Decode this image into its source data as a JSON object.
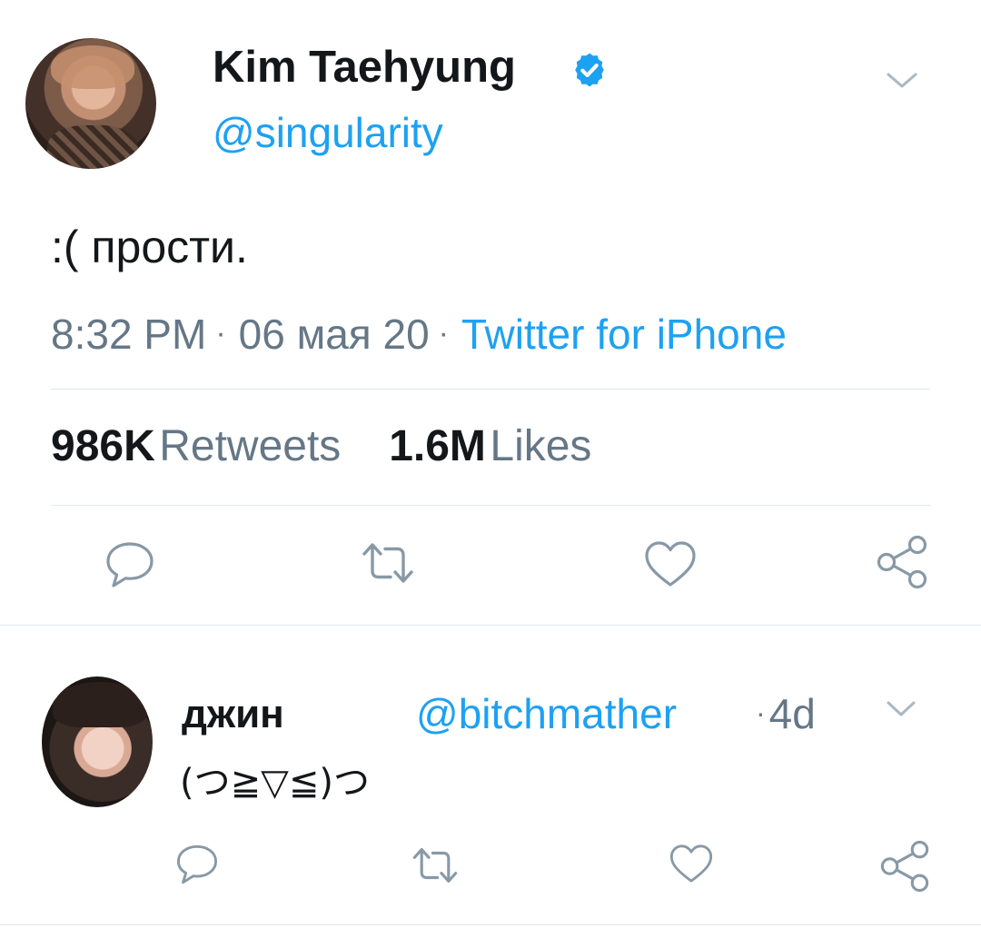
{
  "main_tweet": {
    "author_name": "Kim Taehyung",
    "handle": "@singularity",
    "verified_icon": "verified-badge-icon",
    "text": ":( прости.",
    "time": "8:32 PM",
    "date": "06 мая 20",
    "source": "Twitter for iPhone",
    "retweets_count": "986K",
    "retweets_label": "Retweets",
    "likes_count": "1.6M",
    "likes_label": "Likes",
    "actions": [
      "reply-icon",
      "retweet-icon",
      "like-icon",
      "share-icon"
    ]
  },
  "reply": {
    "author_name": "джин",
    "handle": "@bitchmather",
    "age": "4d",
    "text": "(つ≧▽≦)つ",
    "actions": [
      "reply-icon",
      "retweet-icon",
      "like-icon",
      "share-icon"
    ]
  },
  "colors": {
    "accent": "#1da1f2",
    "text": "#14171a",
    "muted": "#657786",
    "icon": "#8899a6",
    "divider": "#e1e8ed"
  }
}
